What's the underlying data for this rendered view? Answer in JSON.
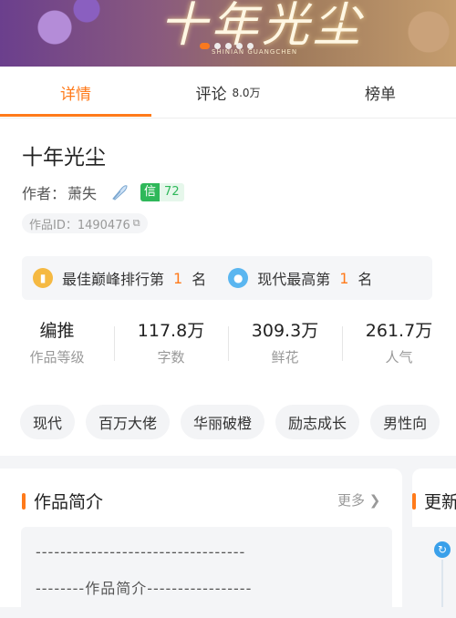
{
  "banner": {
    "title": "十年光尘",
    "subtitle": "SHINIAN GUANGCHEN",
    "dots": 5,
    "active_dot": 0
  },
  "tabs": [
    {
      "label": "详情",
      "count": ""
    },
    {
      "label": "评论",
      "count": "8.0万"
    },
    {
      "label": "榜单",
      "count": ""
    }
  ],
  "book": {
    "title": "十年光尘",
    "author_prefix": "作者：",
    "author": "萧失",
    "trust_label": "信",
    "trust_value": "72",
    "work_id": "作品ID：1490476"
  },
  "ranks": [
    {
      "prefix": "最佳巅峰排行第",
      "num": "1",
      "suffix": "名",
      "icon": "trophy-icon"
    },
    {
      "prefix": "现代最高第",
      "num": "1",
      "suffix": "名",
      "icon": "medal-icon"
    }
  ],
  "stats": [
    {
      "value": "编推",
      "label": "作品等级"
    },
    {
      "value": "117.8万",
      "label": "字数"
    },
    {
      "value": "309.3万",
      "label": "鲜花"
    },
    {
      "value": "261.7万",
      "label": "人气"
    }
  ],
  "tags": [
    "现代",
    "百万大佬",
    "华丽破橙",
    "励志成长",
    "男性向"
  ],
  "intro": {
    "title": "作品简介",
    "more": "更多 ❯",
    "line1": "----------------------------------",
    "line2": "--------作品简介-----------------"
  },
  "update": {
    "title": "更新"
  },
  "colors": {
    "accent": "#ff7a1a",
    "trust": "#2fb85a"
  }
}
